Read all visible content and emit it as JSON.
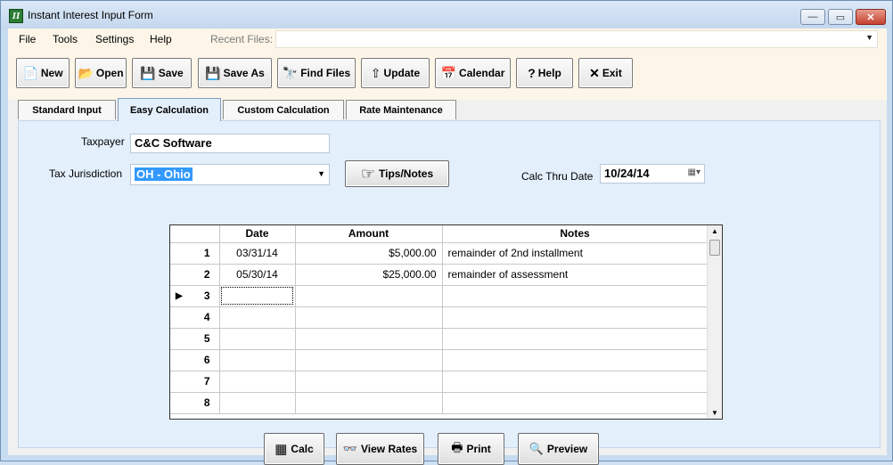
{
  "window": {
    "title": "Instant Interest Input Form",
    "app_icon_letter": "II",
    "min_glyph": "—",
    "max_glyph": "▭",
    "close_glyph": "✕"
  },
  "menu": {
    "file": "File",
    "tools": "Tools",
    "settings": "Settings",
    "help": "Help",
    "recent_files_label": "Recent Files:",
    "recent_files_value": ""
  },
  "toolbar": {
    "buttons": [
      {
        "label": "New",
        "icon": "📄"
      },
      {
        "label": "Open",
        "icon": "📂"
      },
      {
        "label": "Save",
        "icon": "💾"
      },
      {
        "label": "Save As",
        "icon": "💾"
      },
      {
        "label": "Find Files",
        "icon": "🔭"
      },
      {
        "label": "Update",
        "icon": "⇧"
      },
      {
        "label": "Calendar",
        "icon": "📅"
      },
      {
        "label": "Help",
        "icon": "?"
      },
      {
        "label": "Exit",
        "icon": "✕"
      }
    ]
  },
  "tabs": [
    {
      "label": "Standard Input",
      "active": false
    },
    {
      "label": "Easy Calculation",
      "active": true
    },
    {
      "label": "Custom Calculation",
      "active": false
    },
    {
      "label": "Rate Maintenance",
      "active": false
    }
  ],
  "form": {
    "taxpayer_label": "Taxpayer",
    "taxpayer_value": "C&C Software",
    "jurisdiction_label": "Tax Jurisdiction",
    "jurisdiction_value": "OH  - Ohio",
    "tips_button": "Tips/Notes",
    "tips_icon": "☞",
    "calc_thru_label": "Calc Thru Date",
    "calc_thru_value": "10/24/14"
  },
  "grid": {
    "headers": {
      "date": "Date",
      "amount": "Amount",
      "notes": "Notes"
    },
    "rows": [
      {
        "num": "1",
        "date": "03/31/14",
        "amount": "$5,000.00",
        "notes": "remainder of 2nd installment"
      },
      {
        "num": "2",
        "date": "05/30/14",
        "amount": "$25,000.00",
        "notes": "remainder of assessment"
      },
      {
        "num": "3",
        "date": "",
        "amount": "",
        "notes": ""
      },
      {
        "num": "4",
        "date": "",
        "amount": "",
        "notes": ""
      },
      {
        "num": "5",
        "date": "",
        "amount": "",
        "notes": ""
      },
      {
        "num": "6",
        "date": "",
        "amount": "",
        "notes": ""
      },
      {
        "num": "7",
        "date": "",
        "amount": "",
        "notes": ""
      },
      {
        "num": "8",
        "date": "",
        "amount": "",
        "notes": ""
      }
    ]
  },
  "actions": {
    "calc": "Calc",
    "calc_icon": "▦",
    "view_rates": "View Rates",
    "view_rates_icon": "👓",
    "print": "Print",
    "print_icon": "🖶",
    "preview": "Preview",
    "preview_icon": "🔍"
  }
}
